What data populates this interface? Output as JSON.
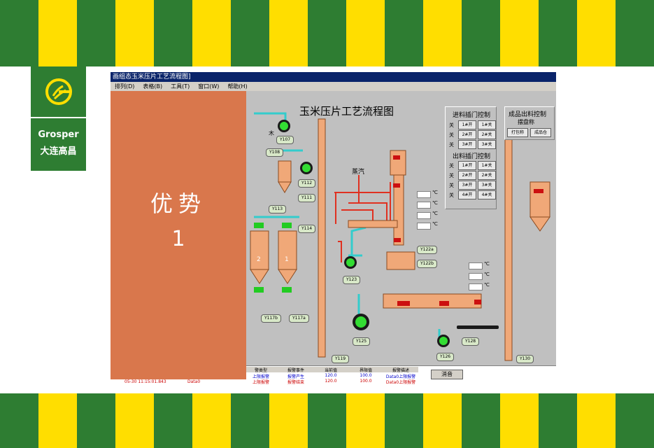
{
  "colors": {
    "stripe_green": "#2e7d32",
    "stripe_yellow": "#ffde00",
    "overlay": "#d9774c",
    "logo_bg": "#2e7d32",
    "pipe_cyan": "#33cccc",
    "pipe_red": "#e03020",
    "equip_orange": "#f0a878"
  },
  "logo": {
    "brand": "Grosper",
    "cn_name": "大连高昌",
    "icon": "grosper-g-icon"
  },
  "overlay": {
    "title": "优势",
    "number": "1"
  },
  "window": {
    "title": "画组态玉米压片工艺流程图]",
    "menu": [
      "排列(D)",
      "表格(B)",
      "工具(T)",
      "窗口(W)",
      "帮助(H)"
    ]
  },
  "flow": {
    "title": "玉米压片工艺流程图",
    "steam_label": "蒸汽",
    "wood_label": "木",
    "inlet_panel": {
      "title": "进料插门控制",
      "rows": [
        {
          "label": "关",
          "open": "1#开",
          "close": "1#关"
        },
        {
          "label": "关",
          "open": "2#开",
          "close": "2#关"
        },
        {
          "label": "关",
          "open": "3#开",
          "close": "3#关"
        }
      ]
    },
    "outlet_panel": {
      "title": "出料插门控制",
      "rows": [
        {
          "label": "关",
          "open": "1#开",
          "close": "1#关"
        },
        {
          "label": "关",
          "open": "2#开",
          "close": "2#关"
        },
        {
          "label": "关",
          "open": "3#开",
          "close": "3#关"
        },
        {
          "label": "关",
          "open": "4#开",
          "close": "4#关"
        }
      ]
    },
    "product_panel": {
      "title": "成品出料控制",
      "subtitle": "摆盘称",
      "buttons": [
        "打包称",
        "成品仓"
      ]
    },
    "silo_numbers": [
      "2",
      "1"
    ],
    "temp_unit": "℃",
    "tags": [
      "Y107",
      "Y108",
      "Y112",
      "Y111",
      "Y113",
      "Y114",
      "Y117b",
      "Y117a",
      "Y119",
      "Y122a",
      "Y122b",
      "Y123",
      "Y125",
      "Y126",
      "Y128",
      "Y130"
    ]
  },
  "alarm": {
    "headers": [
      "警类型",
      "报警事件",
      "当前值",
      "界限值",
      "报警描述"
    ],
    "rows": [
      [
        "上限报警",
        "报警产生",
        "120.0",
        "100.0",
        "Data0上限报警"
      ],
      [
        "上限报警",
        "报警结束",
        "120.0",
        "100.0",
        "Data0上限报警"
      ]
    ],
    "time_row": {
      "time": "05-30 11:15:01.843",
      "source": "Data0"
    },
    "mute_button": "消音"
  }
}
